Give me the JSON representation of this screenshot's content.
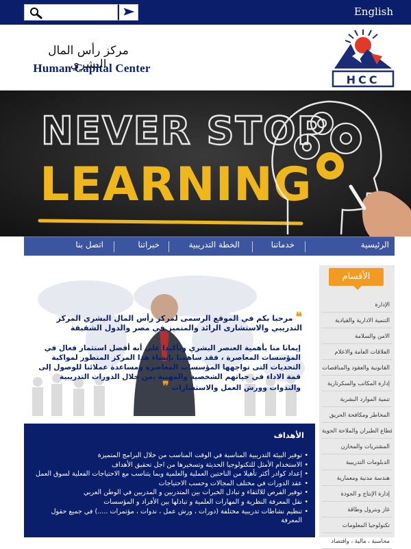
{
  "topbar": {
    "search": {
      "placeholder": ""
    },
    "language_link": "English"
  },
  "header": {
    "title_ar": "مركز رأس المال البشري",
    "title_en": "Human Capital Center",
    "logo_text": "HCC"
  },
  "hero": {
    "line1": "NEVER STOP",
    "line2": "LEARNING"
  },
  "nav": {
    "items": [
      "الرئيسية",
      "خدماتنا",
      "الخطة التدريبية",
      "خبراتنا",
      "اتصل بنا"
    ]
  },
  "sidebar": {
    "title": "الأقسام",
    "items": [
      "الإدارة",
      "التنمية الادارية والقيادية",
      "الامن والسلامة",
      "العلاقات العامة والاعلام",
      "القانونية والعقود والمناقصات",
      "إدارة المكاتب والسكرتارية",
      "تنمية الموارد البشرية",
      "المخاطر ومكافحة الحريق",
      "قطاع الطيران والملاحة الجوية",
      "المشتريات والمخازن",
      "الدبلومات التدريبية",
      "هندسة مدنية ومعمارية",
      "إدارة الإنتاج و الجودة",
      "غاز وبترول وطاقة",
      "تكنولوجيا المعلومات",
      "محاسبة ، مالية ، واقتصاد"
    ]
  },
  "welcome": {
    "paragraph1": "مرحبا بكم في الموقع الرسمى لمركز رأس المال البشري المركز التدريبي والاستشارى الرائد والمتميز في مصر والدول الشقيقة",
    "paragraph2": "إيمانا منا بأهمية العنصر البشري وتأكيدا على أنه أفضل استثمار فعال في المؤسسات المعاصرة ، فقد ساهمنا بإنشاء هذا المركز المتطور لمواكبة التحديات التى تواجهها المؤسسات المعاصرة ومساعدة عملائنا للوصول إلى قمة الاداء في حياتهم الشخصية والمهنية ،من خلال الدورات التدريبية والندوات وورش العمل والاستشارات"
  },
  "goals": {
    "title": "الأهداف",
    "items": [
      "توفير البيئة التدريبية المناسبة في الوقت المناسب من خلال البرامج المتميزة",
      "الاستخدام الأمثل للتكنولوجيا الحديثة وتسخيرها من اجل تحقيق الأهداف",
      "إعداد كوادر أكثر تأهيلا من الناحتين العملية والعلمية وبما يتناسب مع الاحتياجات الفعلية لسوق العمل",
      "عقد الدورات في مختلف المجالات وحسب الاحتياجات",
      "توفير الفرص للالتقاء و تبادل الخبرات بين المتدربين و المدربين في الوطن العربي",
      "نقل المعرفة النظرية و المهارات العلمية و تبادلها بين الأفراد و المؤسسات",
      "تنظيم نشاطات تدريبية مختلفة (دورات ، ورش عمل ، ندوات ، مؤتمرات .....) في جميع حقول المعرفة"
    ]
  },
  "colors": {
    "navy": "#0a1e6c",
    "nav_blue": "#3c55a0",
    "accent_orange": "#f39a23",
    "sidebar_bg": "#e9e9e9"
  }
}
